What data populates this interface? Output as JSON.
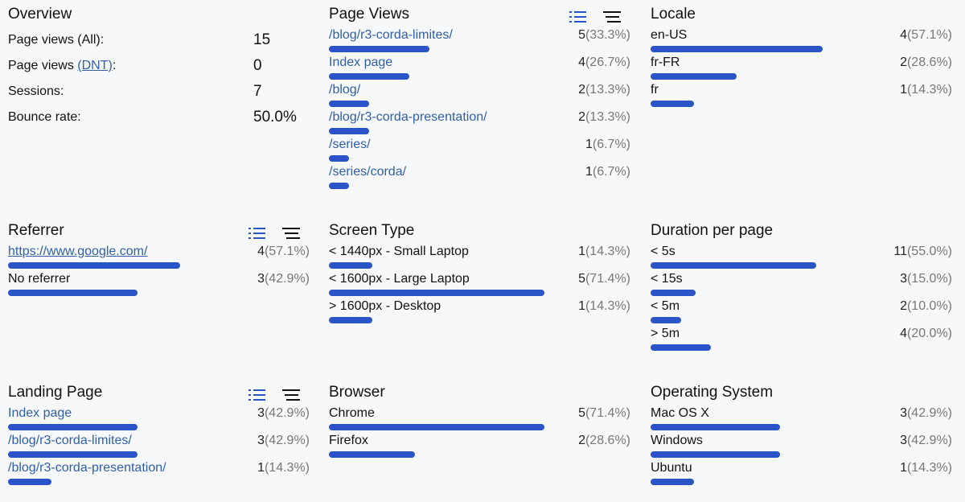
{
  "overview": {
    "title": "Overview",
    "rows": [
      {
        "label": "Page views (All):",
        "value": "15"
      },
      {
        "label_prefix": "Page views ",
        "link": "(DNT)",
        "label_suffix": ":",
        "value": "0"
      },
      {
        "label": "Sessions:",
        "value": "7"
      },
      {
        "label": "Bounce rate:",
        "value": "50.0%"
      }
    ]
  },
  "page_views": {
    "title": "Page Views",
    "rows": [
      {
        "label": "/blog/r3-corda-limites/",
        "count": "5",
        "pct": "(33.3%)",
        "share": 0.333
      },
      {
        "label": "Index page",
        "count": "4",
        "pct": "(26.7%)",
        "share": 0.267
      },
      {
        "label": "/blog/",
        "count": "2",
        "pct": "(13.3%)",
        "share": 0.133
      },
      {
        "label": "/blog/r3-corda-presentation/",
        "count": "2",
        "pct": "(13.3%)",
        "share": 0.133
      },
      {
        "label": "/series/",
        "count": "1",
        "pct": "(6.7%)",
        "share": 0.067
      },
      {
        "label": "/series/corda/",
        "count": "1",
        "pct": "(6.7%)",
        "share": 0.067
      }
    ]
  },
  "locale": {
    "title": "Locale",
    "rows": [
      {
        "label": "en-US",
        "count": "4",
        "pct": "(57.1%)",
        "share": 0.571
      },
      {
        "label": "fr-FR",
        "count": "2",
        "pct": "(28.6%)",
        "share": 0.286
      },
      {
        "label": "fr",
        "count": "1",
        "pct": "(14.3%)",
        "share": 0.143
      }
    ]
  },
  "referrer": {
    "title": "Referrer",
    "rows": [
      {
        "label": "https://www.google.com/",
        "count": "4",
        "pct": "(57.1%)",
        "share": 0.571
      },
      {
        "label": "No referrer",
        "count": "3",
        "pct": "(42.9%)",
        "share": 0.429
      }
    ]
  },
  "screen_type": {
    "title": "Screen Type",
    "rows": [
      {
        "label": "< 1440px - Small Laptop",
        "count": "1",
        "pct": "(14.3%)",
        "share": 0.143
      },
      {
        "label": "< 1600px - Large Laptop",
        "count": "5",
        "pct": "(71.4%)",
        "share": 0.714
      },
      {
        "label": "> 1600px - Desktop",
        "count": "1",
        "pct": "(14.3%)",
        "share": 0.143
      }
    ]
  },
  "duration": {
    "title": "Duration per page",
    "rows": [
      {
        "label": "< 5s",
        "count": "11",
        "pct": "(55.0%)",
        "share": 0.55
      },
      {
        "label": "< 15s",
        "count": "3",
        "pct": "(15.0%)",
        "share": 0.15
      },
      {
        "label": "< 5m",
        "count": "2",
        "pct": "(10.0%)",
        "share": 0.1
      },
      {
        "label": "> 5m",
        "count": "4",
        "pct": "(20.0%)",
        "share": 0.2
      }
    ]
  },
  "landing_page": {
    "title": "Landing Page",
    "rows": [
      {
        "label": "Index page",
        "count": "3",
        "pct": "(42.9%)",
        "share": 0.429
      },
      {
        "label": "/blog/r3-corda-limites/",
        "count": "3",
        "pct": "(42.9%)",
        "share": 0.429
      },
      {
        "label": "/blog/r3-corda-presentation/",
        "count": "1",
        "pct": "(14.3%)",
        "share": 0.143
      }
    ]
  },
  "browser": {
    "title": "Browser",
    "rows": [
      {
        "label": "Chrome",
        "count": "5",
        "pct": "(71.4%)",
        "share": 0.714
      },
      {
        "label": "Firefox",
        "count": "2",
        "pct": "(28.6%)",
        "share": 0.286
      }
    ]
  },
  "os": {
    "title": "Operating System",
    "rows": [
      {
        "label": "Mac OS X",
        "count": "3",
        "pct": "(42.9%)",
        "share": 0.429
      },
      {
        "label": "Windows",
        "count": "3",
        "pct": "(42.9%)",
        "share": 0.429
      },
      {
        "label": "Ubuntu",
        "count": "1",
        "pct": "(14.3%)",
        "share": 0.143
      }
    ]
  },
  "colors": {
    "bar": "#2a55c9",
    "link": "#2f5fa8",
    "active_toggle": "#2a55c9"
  },
  "icons": {
    "list_view": "list-icon",
    "bar_view": "bars-icon"
  }
}
